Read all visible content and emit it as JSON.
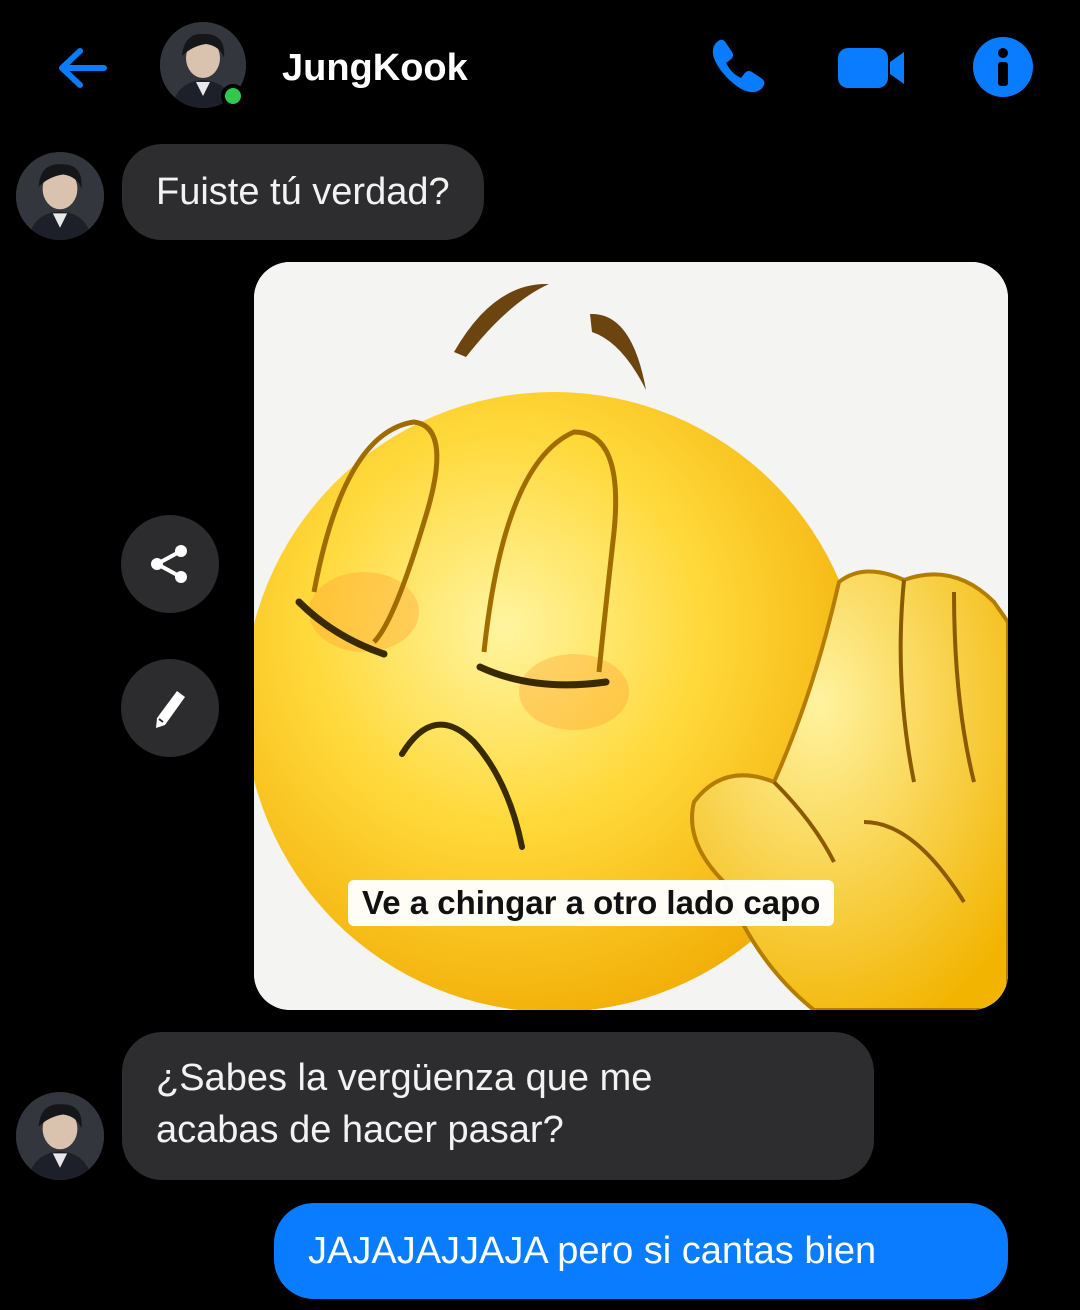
{
  "header": {
    "contact_name": "JungKook",
    "online": true,
    "icons": [
      "back-arrow-icon",
      "phone-icon",
      "video-camera-icon",
      "info-icon"
    ],
    "accent_color": "#0a7cff"
  },
  "messages": [
    {
      "direction": "incoming",
      "type": "text",
      "text": "Fuiste tú verdad?"
    },
    {
      "direction": "outgoing",
      "type": "image",
      "caption": "Ve a chingar a otro lado capo"
    },
    {
      "direction": "incoming",
      "type": "text",
      "lines": [
        "¿Sabes la vergüenza que me",
        "acabas de hacer pasar?"
      ]
    },
    {
      "direction": "outgoing",
      "type": "text",
      "text": "JAJAJAJJAJA pero si cantas bien"
    }
  ],
  "image_actions": [
    "share-icon",
    "edit-pencil-icon"
  ],
  "colors": {
    "background": "#000000",
    "incoming_bubble": "#2d2d2f",
    "outgoing_bubble": "#0a7cff",
    "online_dot": "#31c94b"
  }
}
